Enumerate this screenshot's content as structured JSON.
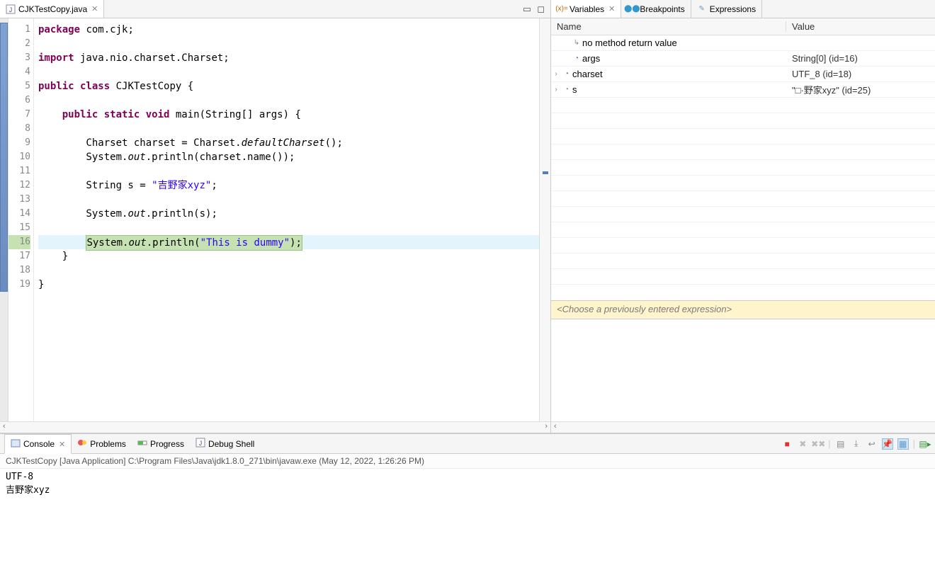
{
  "editor": {
    "tab_label": "CJKTestCopy.java",
    "lines": [
      {
        "n": 1,
        "html": "<span class='tok-kw'>package</span> com.cjk;"
      },
      {
        "n": 2,
        "html": ""
      },
      {
        "n": 3,
        "html": "<span class='tok-kw'>import</span> java.nio.charset.Charset;"
      },
      {
        "n": 4,
        "html": ""
      },
      {
        "n": 5,
        "html": "<span class='tok-kw'>public class</span> CJKTestCopy {"
      },
      {
        "n": 6,
        "html": ""
      },
      {
        "n": 7,
        "html": "    <span class='tok-kw'>public static void</span> main(String[] args) {"
      },
      {
        "n": 8,
        "html": ""
      },
      {
        "n": 9,
        "html": "        Charset charset = Charset.<span class='tok-it'>defaultCharset</span>();"
      },
      {
        "n": 10,
        "html": "        System.<span class='tok-it'>out</span>.println(charset.name());"
      },
      {
        "n": 11,
        "html": ""
      },
      {
        "n": 12,
        "html": "        String s = <span class='tok-str'>\"吉野家xyz\"</span>;"
      },
      {
        "n": 13,
        "html": ""
      },
      {
        "n": 14,
        "html": "        System.<span class='tok-it'>out</span>.println(s);"
      },
      {
        "n": 15,
        "html": ""
      },
      {
        "n": 16,
        "html": "        <span class='inst-ptr'>System.<span class='tok-it'>out</span>.println(<span class='tok-str'>\"This is dummy\"</span>);</span>",
        "current": true
      },
      {
        "n": 17,
        "html": "    }"
      },
      {
        "n": 18,
        "html": ""
      },
      {
        "n": 19,
        "html": "}"
      }
    ],
    "current_line": 16
  },
  "right_tabs": {
    "variables": "Variables",
    "breakpoints": "Breakpoints",
    "expressions": "Expressions"
  },
  "vars_header": {
    "name": "Name",
    "value": "Value"
  },
  "vars": [
    {
      "indent": 1,
      "expander": "",
      "icon_color": "#888",
      "icon": "↳",
      "name": "no method return value",
      "value": ""
    },
    {
      "indent": 1,
      "expander": "",
      "icon_color": "#669",
      "icon": "◔",
      "name": "args",
      "value": "String[0]  (id=16)"
    },
    {
      "indent": 0,
      "expander": "›",
      "icon_color": "#669",
      "icon": "◔",
      "name": "charset",
      "value": "UTF_8  (id=18)"
    },
    {
      "indent": 0,
      "expander": "›",
      "icon_color": "#888",
      "icon": "◔",
      "name": "s",
      "value": "\"□·野家xyz\" (id=25)"
    }
  ],
  "expression_placeholder": "<Choose a previously entered expression>",
  "bottom_tabs": {
    "console": "Console",
    "problems": "Problems",
    "progress": "Progress",
    "debug_shell": "Debug Shell"
  },
  "console": {
    "launch": "CJKTestCopy [Java Application] C:\\Program Files\\Java\\jdk1.8.0_271\\bin\\javaw.exe  (May 12, 2022, 1:26:26 PM)",
    "output": "UTF-8\n吉野家xyz"
  }
}
